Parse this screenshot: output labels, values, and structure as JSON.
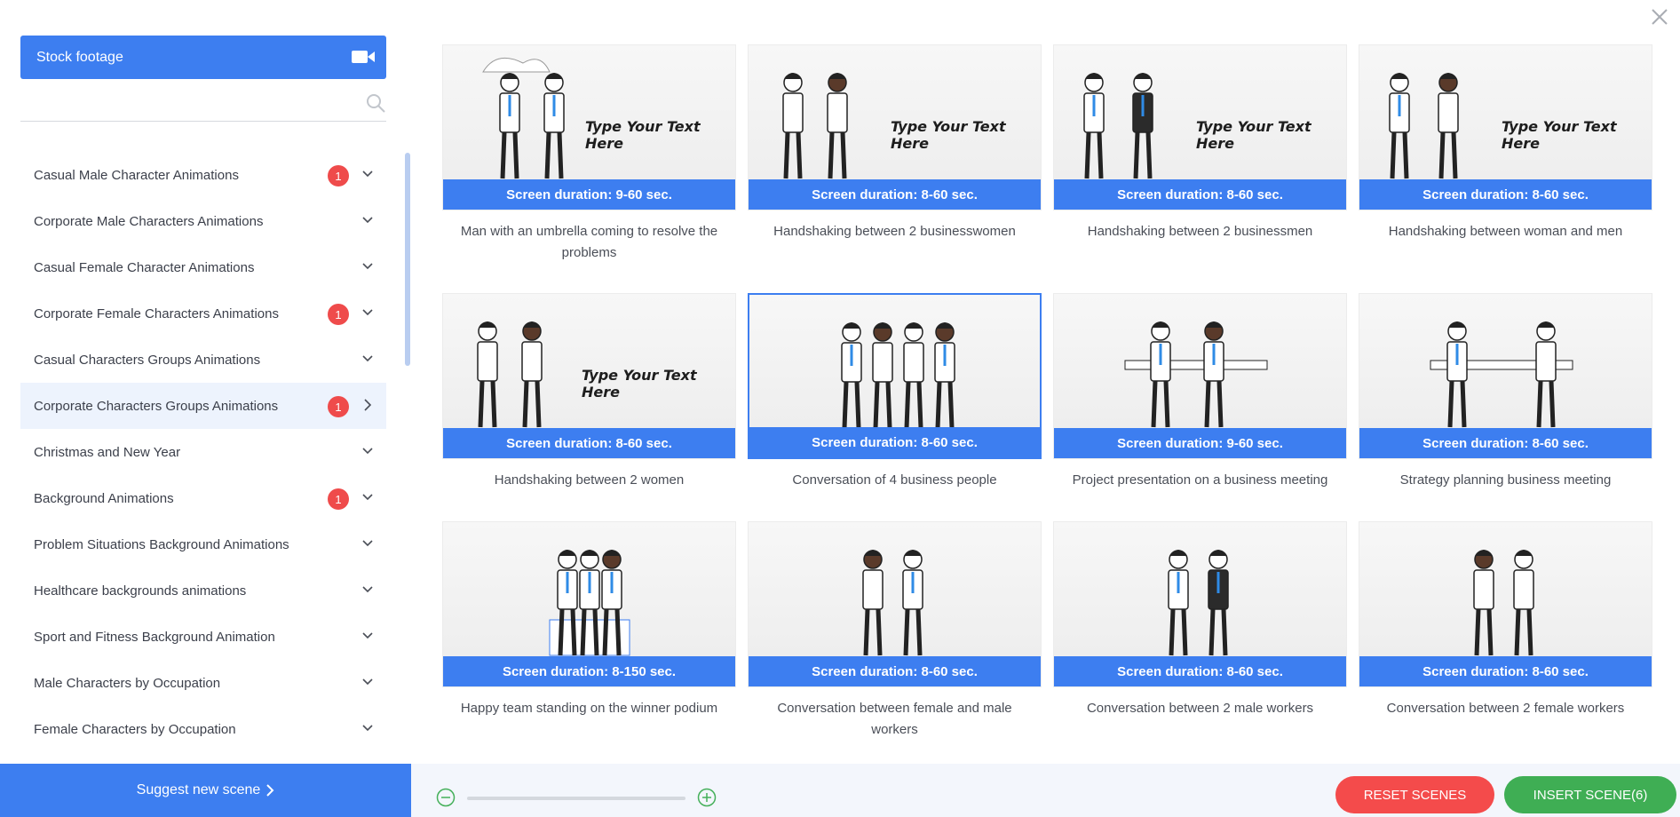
{
  "sidebar": {
    "stock_label": "Stock footage",
    "search_placeholder": "",
    "categories": [
      {
        "label": "Casual Male Character Animations",
        "badge": "1"
      },
      {
        "label": "Corporate Male Characters Animations",
        "badge": ""
      },
      {
        "label": "Casual Female Character Animations",
        "badge": ""
      },
      {
        "label": "Corporate Female Characters Animations",
        "badge": "1"
      },
      {
        "label": "Casual Characters Groups Animations",
        "badge": ""
      },
      {
        "label": "Corporate Characters Groups Animations",
        "badge": "1"
      },
      {
        "label": "Christmas and New Year",
        "badge": ""
      },
      {
        "label": "Background Animations",
        "badge": "1"
      },
      {
        "label": "Problem Situations Background Animations",
        "badge": ""
      },
      {
        "label": "Healthcare backgrounds animations",
        "badge": ""
      },
      {
        "label": "Sport and Fitness Background Animation",
        "badge": ""
      },
      {
        "label": "Male Characters by Occupation",
        "badge": ""
      },
      {
        "label": "Female Characters by Occupation",
        "badge": ""
      }
    ],
    "suggest_label": "Suggest new scene"
  },
  "scenes": [
    {
      "duration": "Screen duration: 9-60 sec.",
      "title": "Man with an umbrella coming to resolve the problems",
      "overlay_text": "Type Your Text Here"
    },
    {
      "duration": "Screen duration: 8-60 sec.",
      "title": "Handshaking between 2 businesswomen",
      "overlay_text": "Type Your Text Here"
    },
    {
      "duration": "Screen duration: 8-60 sec.",
      "title": "Handshaking between 2 businessmen",
      "overlay_text": "Type Your Text Here"
    },
    {
      "duration": "Screen duration: 8-60 sec.",
      "title": "Handshaking between woman and men",
      "overlay_text": "Type Your Text Here"
    },
    {
      "duration": "Screen duration: 8-60 sec.",
      "title": "Handshaking between 2 women",
      "overlay_text": "Type Your Text Here"
    },
    {
      "duration": "Screen duration: 8-60 sec.",
      "title": "Conversation of 4 business people",
      "overlay_text": ""
    },
    {
      "duration": "Screen duration: 9-60 sec.",
      "title": "Project presentation on a business meeting",
      "overlay_text": ""
    },
    {
      "duration": "Screen duration: 8-60 sec.",
      "title": "Strategy planning business meeting",
      "overlay_text": ""
    },
    {
      "duration": "Screen duration: 8-150 sec.",
      "title": "Happy team standing on the winner podium",
      "overlay_text": ""
    },
    {
      "duration": "Screen duration: 8-60 sec.",
      "title": "Conversation between female and male workers",
      "overlay_text": ""
    },
    {
      "duration": "Screen duration: 8-60 sec.",
      "title": "Conversation between 2 male workers",
      "overlay_text": ""
    },
    {
      "duration": "Screen duration: 8-60 sec.",
      "title": "Conversation between 2 female workers",
      "overlay_text": ""
    }
  ],
  "bottom": {
    "reset_label": "RESET SCENES",
    "insert_label": "INSERT SCENE(6)"
  },
  "colors": {
    "accent": "#3d7ef0",
    "reset": "#f44b4b",
    "insert": "#3fae54",
    "badge": "#ef4b4b"
  }
}
